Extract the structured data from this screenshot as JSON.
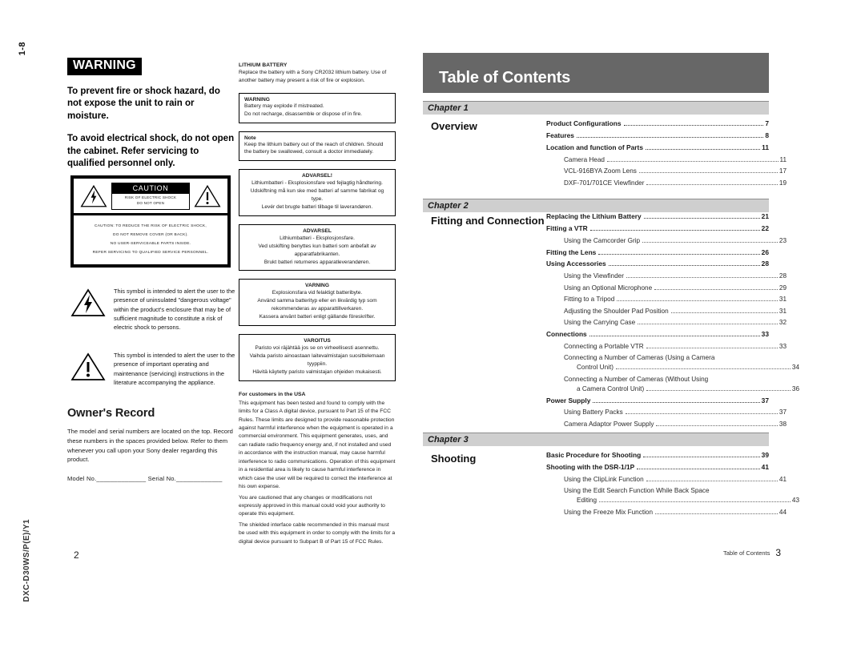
{
  "left_page": {
    "page_marker": "1-8",
    "doc_code": "DXC-D30WS/P(E)/Y1",
    "folio": "2",
    "warning": {
      "badge": "WARNING",
      "para1": "To prevent fire or shock hazard, do not expose the unit to rain or moisture.",
      "para2": "To avoid electrical shock, do not open the cabinet. Refer servicing to qualified personnel only."
    },
    "caution_panel": {
      "title": "CAUTION",
      "sub_line1": "RISK OF ELECTRIC SHOCK",
      "sub_line2": "DO NOT OPEN",
      "body_line1": "CAUTION: TO REDUCE THE RISK OF ELECTRIC SHOCK,",
      "body_line2": "DO NOT REMOVE COVER (OR BACK).",
      "body_line3": "NO USER-SERVICEABLE PARTS INSIDE.",
      "body_line4": "REFER SERVICING TO QUALIFIED SERVICE PERSONNEL."
    },
    "symbols": [
      {
        "icon": "lightning-bolt-triangle-icon",
        "text": "This symbol is intended to alert the user to the presence of uninsulated \"dangerous voltage\" within the product's enclosure that may be of sufficient magnitude to constitute a risk of electric shock to persons."
      },
      {
        "icon": "exclamation-triangle-icon",
        "text": "This symbol is intended to alert the user to the presence of important operating and maintenance (servicing) instructions in the literature accompanying the appliance."
      }
    ],
    "owners_record": {
      "title": "Owner's Record",
      "body": "The model and serial numbers are located on the top. Record these numbers in the spaces provided below. Refer to them whenever you call upon your Sony dealer regarding this product.",
      "fields": "Model No.______________    Serial No._____________"
    },
    "battery_column": {
      "lithium_head": "LITHIUM BATTERY",
      "lithium_text": "Replace the battery with a Sony CR2032 lithium battery. Use of another battery may present a risk of fire or explosion.",
      "boxes": [
        {
          "id": "warning-box",
          "centered": false,
          "title": "WARNING",
          "lines": [
            "Battery may explode if mistreated.",
            "Do not recharge, disassemble or dispose of in fire."
          ]
        },
        {
          "id": "note-box",
          "centered": false,
          "title": "Note",
          "lines": [
            "Keep the lithium battery out of the reach of children. Should the battery be swallowed, consult a doctor immediately."
          ]
        },
        {
          "id": "advarsel-da-box",
          "centered": true,
          "title": "ADVARSEL!",
          "lines": [
            "Lithiumbatteri - Eksplosionsfare ved fejlagtig håndtering. Udskiftning må kun ske med batteri af samme fabrikat og type.",
            "Levér det brugte batteri tilbage til laverandøren."
          ]
        },
        {
          "id": "advarsel-no-box",
          "centered": true,
          "title": "ADVARSEL",
          "lines": [
            "Lithiumbatteri - Eksplosjonsfare.",
            "Ved utskifting benyttes kun batteri som anbefalt av apparatfabrikanten.",
            "Brukt batteri returneres apparatleverandøren."
          ]
        },
        {
          "id": "varning-sv-box",
          "centered": true,
          "title": "VARNING",
          "lines": [
            "Explosionsfara vid felaktigt batteribyte.",
            "Använd samma batterityp eller en likvärdig typ som rekommenderas av apparattillverkaren.",
            "Kassera använt batteri enligt gällande föreskrifter."
          ]
        },
        {
          "id": "varoitus-fi-box",
          "centered": true,
          "title": "VAROITUS",
          "lines": [
            "Paristo voi räjähtää jos se on virheellisesti asennettu.",
            "Vaihda paristo ainoastaan laitevalmistajan suosittelemaan tyyppiin.",
            "Hävitä käytetty paristo valmistajan ohjeiden mukaisesti."
          ]
        }
      ],
      "fcc_head": "For customers in the USA",
      "fcc_para1": "This equipment has been tested and found to comply with the limits for a Class A digital device, pursuant to Part 15 of the FCC Rules.  These limits are designed to provide reasonable protection against harmful interference when the equipment is operated in a commercial environment.  This equipment generates, uses, and can radiate radio frequency energy and, if not installed and used in accordance with the instruction manual, may cause harmful interference to radio communications.  Operation of this equipment in a residential area is likely to cause harmful interference in which case the user will be required to correct the interference at his own expense.",
      "fcc_para2": "You are cautioned that any changes or modifications not expressly approved in this manual could void your authority to operate this equipment.",
      "fcc_para3": "The shielded interface cable recommended in this manual must be used with this equipment in order to comply with the limits for a digital device pursuant to Subpart B of Part 15 of FCC Rules."
    }
  },
  "right_page": {
    "banner_title": "Table of Contents",
    "footer_label": "Table of Contents",
    "folio": "3",
    "chapters": [
      {
        "band": "Chapter 1",
        "name": "Overview",
        "entries": [
          {
            "level": 1,
            "label": "Product Configurations",
            "page": "7"
          },
          {
            "level": 1,
            "label": "Features",
            "page": "8"
          },
          {
            "level": 1,
            "label": "Location and function of Parts",
            "page": "11"
          },
          {
            "level": 2,
            "label": "Camera Head",
            "page": "11"
          },
          {
            "level": 2,
            "label": "VCL-916BYA Zoom Lens",
            "page": "17"
          },
          {
            "level": 2,
            "label": "DXF-701/701CE Viewfinder",
            "page": "19"
          }
        ]
      },
      {
        "band": "Chapter 2",
        "name": "Fitting and Connection",
        "entries": [
          {
            "level": 1,
            "label": "Replacing the Lithium Battery",
            "page": "21"
          },
          {
            "level": 1,
            "label": "Fitting a VTR",
            "page": "22"
          },
          {
            "level": 2,
            "label": "Using the Camcorder Grip",
            "page": "23"
          },
          {
            "level": 1,
            "label": "Fitting the Lens",
            "page": "26"
          },
          {
            "level": 1,
            "label": "Using Accessories",
            "page": "28"
          },
          {
            "level": 2,
            "label": "Using the Viewfinder",
            "page": "28"
          },
          {
            "level": 2,
            "label": "Using an Optional Microphone",
            "page": "29"
          },
          {
            "level": 2,
            "label": "Fitting to a Tripod",
            "page": "31"
          },
          {
            "level": 2,
            "label": "Adjusting the Shoulder Pad Position",
            "page": "31"
          },
          {
            "level": 2,
            "label": "Using the Carrying Case",
            "page": "32"
          },
          {
            "level": 1,
            "label": "Connections",
            "page": "33"
          },
          {
            "level": 2,
            "label": "Connecting a Portable VTR",
            "page": "33"
          },
          {
            "level": 2,
            "label": "Connecting a Number of Cameras (Using a Camera",
            "page": "",
            "wrap": true
          },
          {
            "level": 3,
            "label": "Control Unit)",
            "page": "34"
          },
          {
            "level": 2,
            "label": "Connecting a Number of Cameras (Without Using",
            "page": "",
            "wrap": true
          },
          {
            "level": 3,
            "label": "a Camera Control Unit)",
            "page": "36"
          },
          {
            "level": 1,
            "label": "Power Supply",
            "page": "37"
          },
          {
            "level": 2,
            "label": "Using Battery Packs",
            "page": "37"
          },
          {
            "level": 2,
            "label": "Camera Adaptor Power Supply",
            "page": "38"
          }
        ]
      },
      {
        "band": "Chapter 3",
        "name": "Shooting",
        "entries": [
          {
            "level": 1,
            "label": "Basic Procedure for Shooting",
            "page": "39"
          },
          {
            "level": 1,
            "label": "Shooting with the DSR-1/1P",
            "page": "41"
          },
          {
            "level": 2,
            "label": "Using the ClipLink Function",
            "page": "41"
          },
          {
            "level": 2,
            "label": "Using the Edit Search Function While Back Space",
            "page": "",
            "wrap": true
          },
          {
            "level": 3,
            "label": "Editing",
            "page": "43"
          },
          {
            "level": 2,
            "label": "Using the Freeze Mix Function",
            "page": "44"
          }
        ]
      }
    ],
    "layout": {
      "chapter_tops": [
        126,
        248,
        540
      ],
      "chapter_name_tops": [
        150,
        268,
        565
      ],
      "list_tops": [
        148,
        264,
        562
      ]
    }
  }
}
